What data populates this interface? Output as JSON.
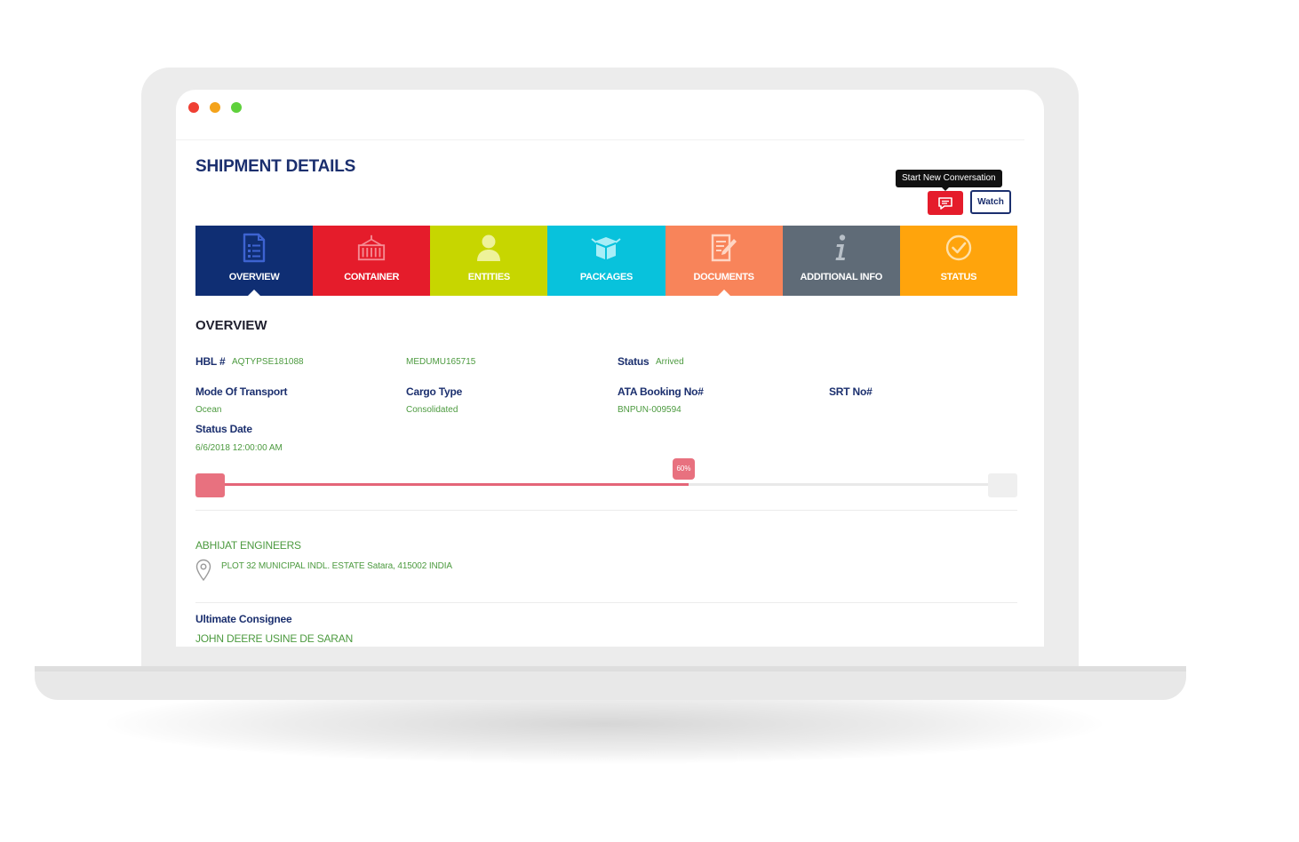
{
  "header": {
    "title": "SHIPMENT DETAILS",
    "tooltip": "Start New Conversation",
    "chat_icon": "chat-icon",
    "watch_label": "Watch"
  },
  "tabs": [
    {
      "label": "OVERVIEW",
      "icon": "document-list-icon",
      "color": "#0f2e73",
      "active": true
    },
    {
      "label": "CONTAINER",
      "icon": "container-icon",
      "color": "#e51c2b",
      "active": false
    },
    {
      "label": "ENTITIES",
      "icon": "user-icon",
      "color": "#c7d600",
      "active": false
    },
    {
      "label": "PACKAGES",
      "icon": "package-icon",
      "color": "#08c2dc",
      "active": false
    },
    {
      "label": "DOCUMENTS",
      "icon": "edit-document-icon",
      "color": "#f8845a",
      "active": false
    },
    {
      "label": "ADDITIONAL INFO",
      "icon": "info-icon",
      "color": "#5f6b77",
      "active": false
    },
    {
      "label": "STATUS",
      "icon": "check-circle-icon",
      "color": "#ffa40c",
      "active": false
    }
  ],
  "overview": {
    "heading": "OVERVIEW",
    "hbl_label": "HBL #",
    "hbl_value": "AQTYPSE181088",
    "container_no": "MEDUMU165715",
    "status_label": "Status",
    "status_value": "Arrived",
    "mode_label": "Mode Of Transport",
    "mode_value": "Ocean",
    "cargo_label": "Cargo Type",
    "cargo_value": "Consolidated",
    "ata_label": "ATA Booking No#",
    "ata_value": "BNPUN-009594",
    "srt_label": "SRT No#",
    "status_date_label": "Status Date",
    "status_date_value": "6/6/2018 12:00:00 AM"
  },
  "progress": {
    "percent": 60,
    "label": "60%",
    "color": "#e46578"
  },
  "entity": {
    "name": "ABHIJAT ENGINEERS",
    "address": "PLOT 32 MUNICIPAL INDL. ESTATE Satara, 415002 INDIA"
  },
  "consignee": {
    "label": "Ultimate Consignee",
    "name": "JOHN DEERE USINE DE SARAN"
  },
  "colors": {
    "navy": "#1b2f6e",
    "green_text": "#4c9a3f",
    "chat_red": "#e51c2b"
  }
}
